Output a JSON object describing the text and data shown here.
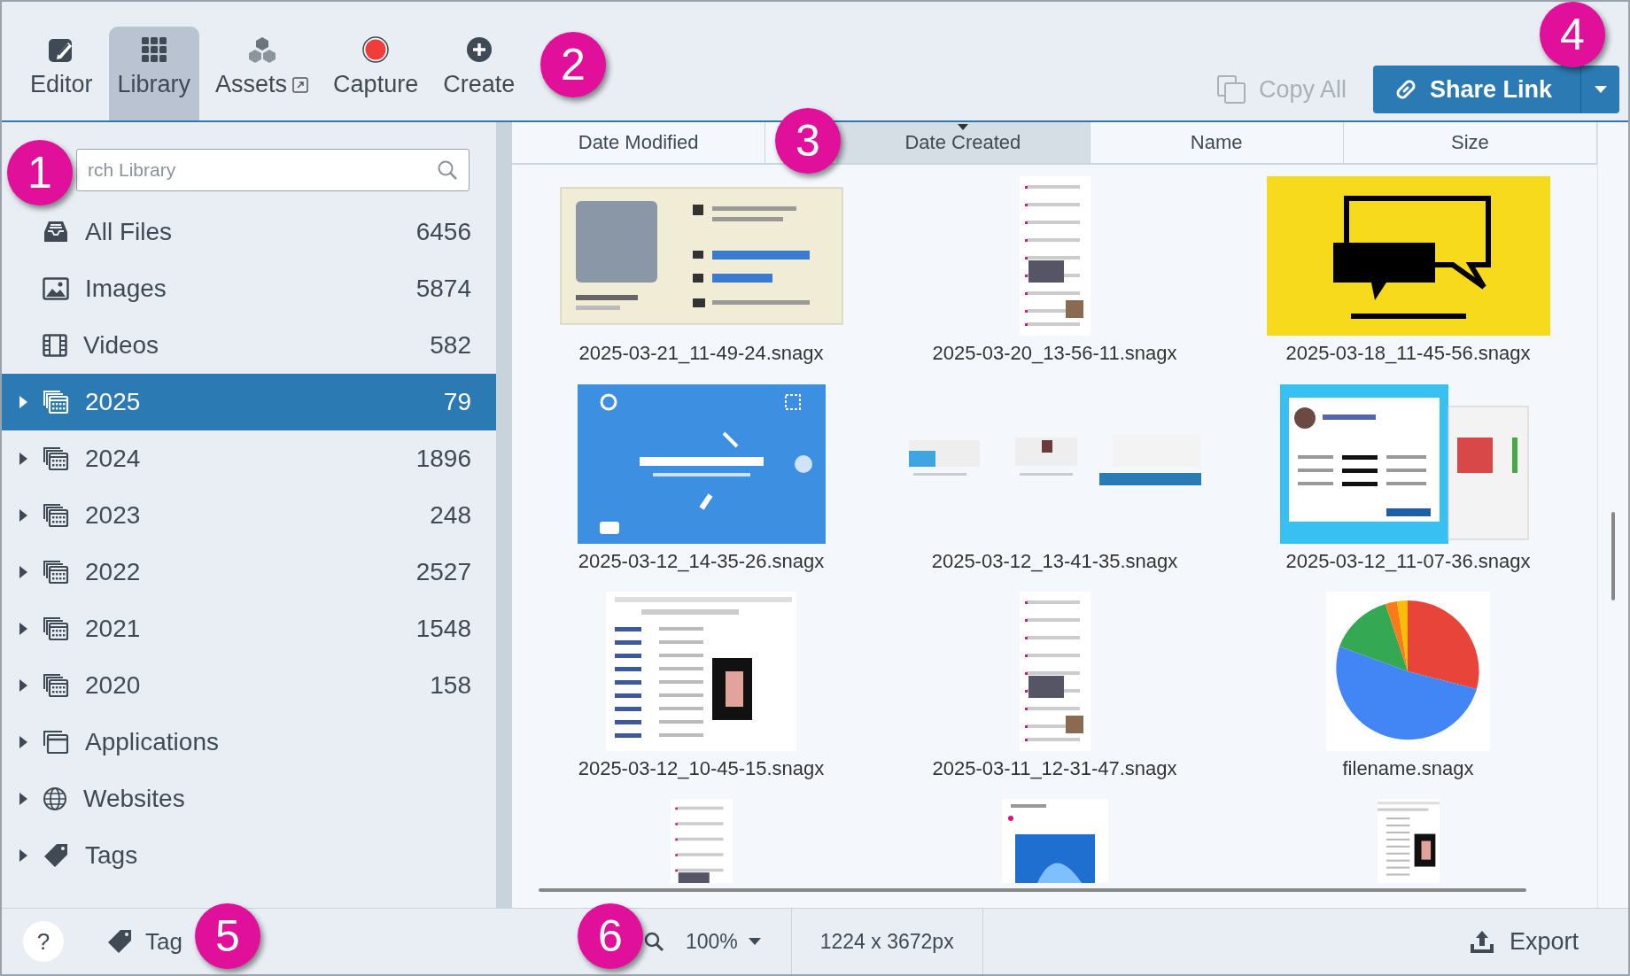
{
  "toolbar": {
    "tabs": [
      {
        "label": "Editor",
        "kind": "editor",
        "external": false,
        "selected": false
      },
      {
        "label": "Library",
        "kind": "library",
        "external": false,
        "selected": true
      },
      {
        "label": "Assets",
        "kind": "assets",
        "external": true,
        "selected": false
      },
      {
        "label": "Capture",
        "kind": "capture",
        "external": false,
        "selected": false
      },
      {
        "label": "Create",
        "kind": "create",
        "external": false,
        "selected": false
      }
    ],
    "copy_all": {
      "label": "Copy All",
      "disabled": true
    },
    "share_link": {
      "label": "Share Link"
    }
  },
  "search": {
    "placeholder": "rch Library"
  },
  "sidebar": {
    "items": [
      {
        "label": "All Files",
        "count": "6456",
        "kind": "inbox",
        "expandable": false,
        "selected": false
      },
      {
        "label": "Images",
        "count": "5874",
        "kind": "image",
        "expandable": false,
        "selected": false
      },
      {
        "label": "Videos",
        "count": "582",
        "kind": "film",
        "expandable": false,
        "selected": false
      },
      {
        "label": "2025",
        "count": "79",
        "kind": "calendar",
        "expandable": true,
        "selected": true
      },
      {
        "label": "2024",
        "count": "1896",
        "kind": "calendar",
        "expandable": true,
        "selected": false
      },
      {
        "label": "2023",
        "count": "248",
        "kind": "calendar",
        "expandable": true,
        "selected": false
      },
      {
        "label": "2022",
        "count": "2527",
        "kind": "calendar",
        "expandable": true,
        "selected": false
      },
      {
        "label": "2021",
        "count": "1548",
        "kind": "calendar",
        "expandable": true,
        "selected": false
      },
      {
        "label": "2020",
        "count": "158",
        "kind": "calendar",
        "expandable": true,
        "selected": false
      },
      {
        "label": "Applications",
        "kind": "window",
        "expandable": true,
        "selected": false
      },
      {
        "label": "Websites",
        "kind": "globe",
        "expandable": true,
        "selected": false
      },
      {
        "label": "Tags",
        "kind": "tag",
        "expandable": true,
        "selected": false
      }
    ]
  },
  "sort_columns": [
    {
      "label": "Date Modified",
      "selected": false
    },
    {
      "label": "Date Created",
      "selected": true
    },
    {
      "label": "Name",
      "selected": false
    },
    {
      "label": "Size",
      "selected": false
    }
  ],
  "files": [
    {
      "name": "2025-03-21_11-49-24.snagx",
      "kind": "card"
    },
    {
      "name": "2025-03-20_13-56-11.snagx",
      "kind": "document"
    },
    {
      "name": "2025-03-18_11-45-56.snagx",
      "kind": "speech"
    },
    {
      "name": "2025-03-12_14-35-26.snagx",
      "kind": "welcome"
    },
    {
      "name": "2025-03-12_13-41-35.snagx",
      "kind": "strip"
    },
    {
      "name": "2025-03-12_11-07-36.snagx",
      "kind": "dialog"
    },
    {
      "name": "2025-03-12_10-45-15.snagx",
      "kind": "webpage"
    },
    {
      "name": "2025-03-11_12-31-47.snagx",
      "kind": "document"
    },
    {
      "name": "filename.snagx",
      "kind": "pie"
    }
  ],
  "partial_files": [
    {
      "kind": "document"
    },
    {
      "kind": "slide"
    },
    {
      "kind": "webpage"
    }
  ],
  "status_bar": {
    "help": "?",
    "tag": "Tag",
    "zoom": "100%",
    "dimensions": "1224 x 3672px",
    "export": "Export"
  },
  "callouts": [
    "1",
    "2",
    "3",
    "4",
    "5",
    "6"
  ]
}
